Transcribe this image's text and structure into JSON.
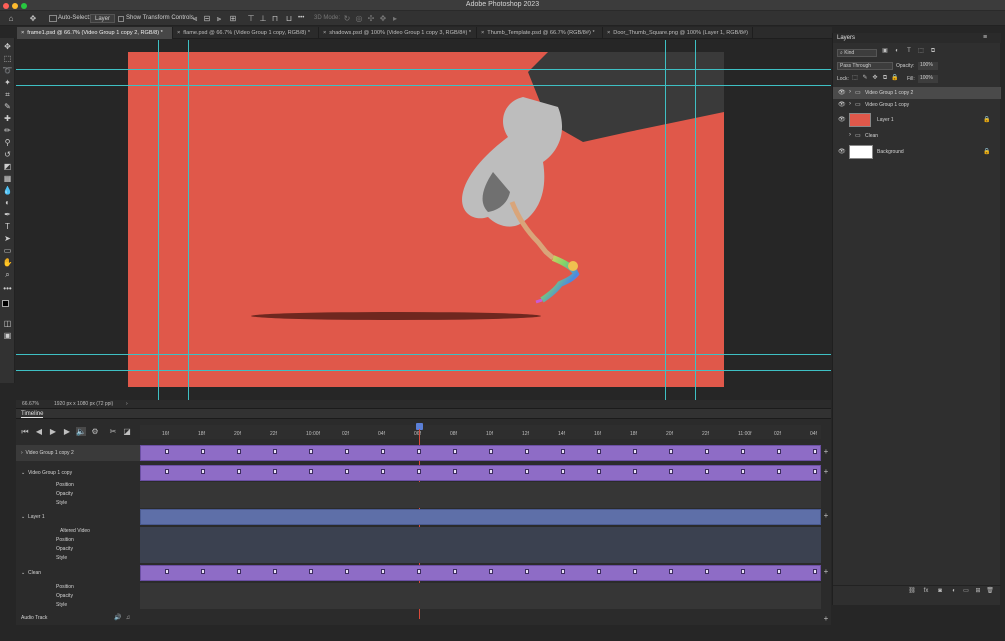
{
  "app": {
    "title": "Adobe Photoshop 2023"
  },
  "options_bar": {
    "auto_select_label": "Auto-Select:",
    "auto_select_value": "Layer",
    "transform_controls_label": "Show Transform Controls",
    "mode_3d_label": "3D Mode:",
    "more_label": "•••"
  },
  "tabs": [
    {
      "label": "frame1.psd @ 66.7% (Video Group 1 copy 2, RGB/8) *",
      "active": true
    },
    {
      "label": "flame.psd @ 66.7% (Video Group 1 copy, RGB/8) *",
      "active": false
    },
    {
      "label": "shadows.psd @ 100% (Video Group 1 copy 3, RGB/8#) *",
      "active": false
    },
    {
      "label": "Thumb_Template.psd @ 66.7% (RGB/8#) *",
      "active": false
    },
    {
      "label": "Door_Thumb_Square.png @ 100% (Layer 1, RGB/8#)",
      "active": false
    }
  ],
  "status": {
    "zoom": "66.67%",
    "doc_info": "1920 px x 1080 px (72 ppi)"
  },
  "timeline": {
    "title": "Timeline",
    "ruler_ticks": [
      "16f",
      "18f",
      "20f",
      "22f",
      "10:00f",
      "02f",
      "04f",
      "06f",
      "08f",
      "10f",
      "12f",
      "14f",
      "16f",
      "18f",
      "20f",
      "22f",
      "11:00f",
      "02f",
      "04f"
    ],
    "tracks": [
      {
        "name": "Video Group 1 copy 2",
        "expanded": false
      },
      {
        "name": "Video Group 1 copy",
        "expanded": true,
        "props": [
          "Position",
          "Opacity",
          "Style"
        ]
      },
      {
        "name": "Layer 1",
        "expanded": true,
        "props": [
          "Altered Video",
          "Position",
          "Opacity",
          "Style"
        ]
      },
      {
        "name": "Clean",
        "expanded": true,
        "props": [
          "Position",
          "Opacity",
          "Style"
        ]
      }
    ],
    "audio_track": "Audio Track"
  },
  "layers_panel": {
    "title": "Layers",
    "kind_label": "Kind",
    "blend_mode": "Pass Through",
    "opacity_label": "Opacity:",
    "opacity_value": "100%",
    "lock_label": "Lock:",
    "fill_label": "Fill:",
    "fill_value": "100%",
    "layers": [
      {
        "name": "Video Group 1 copy 2",
        "type": "group",
        "selected": true,
        "visible": true
      },
      {
        "name": "Video Group 1 copy",
        "type": "group",
        "selected": false,
        "visible": true
      },
      {
        "name": "Layer 1",
        "type": "layer",
        "selected": false,
        "visible": true,
        "locked": true
      },
      {
        "name": "Clean",
        "type": "group",
        "selected": false,
        "visible": false
      },
      {
        "name": "Background",
        "type": "layer",
        "selected": false,
        "visible": true,
        "locked": true
      }
    ]
  },
  "colors": {
    "canvas_bg": "#e0584a",
    "clip_purple": "#8e6cc6",
    "clip_blue": "#5e6fa8",
    "guide": "#3ec0c4",
    "playhead": "#d94a3a"
  }
}
